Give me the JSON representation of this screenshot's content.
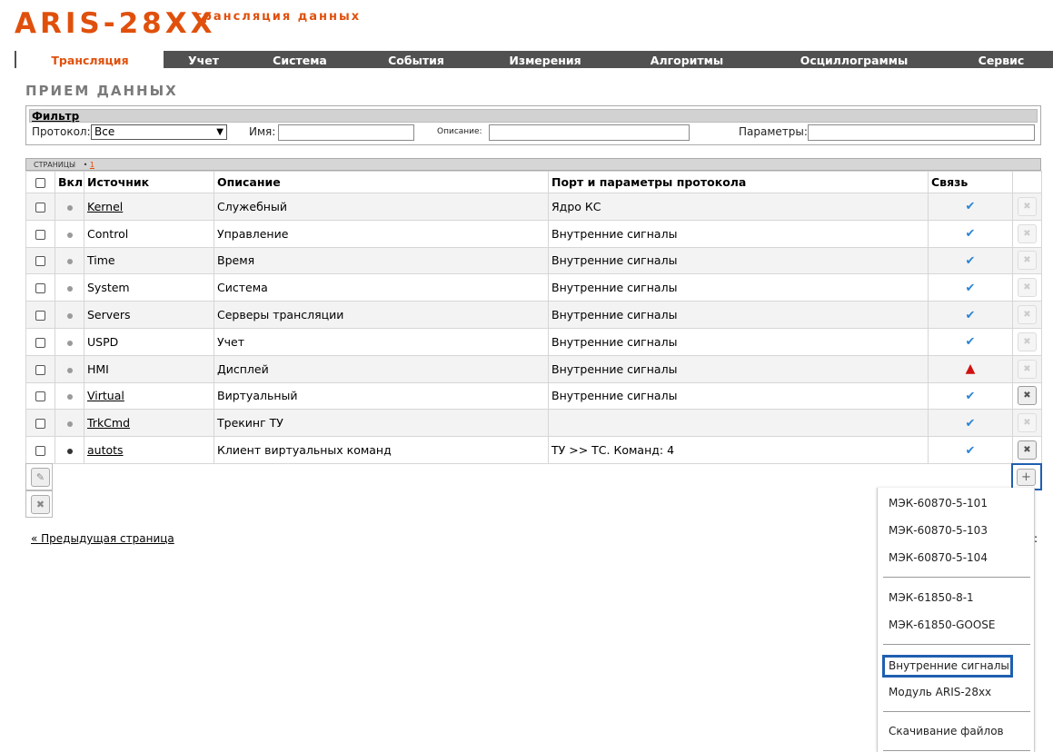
{
  "header": {
    "brand": "ARIS-28XX",
    "subtitle": "трансляция данных"
  },
  "nav": [
    {
      "label": "Трансляция",
      "active": true
    },
    {
      "label": "Учет"
    },
    {
      "label": "Система"
    },
    {
      "label": "События"
    },
    {
      "label": "Измерения"
    },
    {
      "label": "Алгоритмы"
    },
    {
      "label": "Осциллограммы"
    },
    {
      "label": "Сервис"
    }
  ],
  "page_title": "ПРИЕМ ДАННЫХ",
  "filter": {
    "title": "Фильтр",
    "protocol_label": "Протокол:",
    "protocol_value": "Все",
    "name_label": "Имя:",
    "desc_label": "Описание:",
    "params_label": "Параметры:"
  },
  "pages": {
    "label": "СТРАНИЦЫ",
    "bullet": "•",
    "current": "1"
  },
  "table": {
    "headers": [
      "Вкл",
      "Источник",
      "Описание",
      "Порт и параметры протокола",
      "Связь"
    ],
    "rows": [
      {
        "source": "Kernel",
        "link": true,
        "desc": "Служебный",
        "port": "Ядро КС",
        "status": "ok",
        "delete": false
      },
      {
        "source": "Control",
        "link": false,
        "desc": "Управление",
        "port": "Внутренние сигналы",
        "status": "ok",
        "delete": false
      },
      {
        "source": "Time",
        "link": false,
        "desc": "Время",
        "port": "Внутренние сигналы",
        "status": "ok",
        "delete": false
      },
      {
        "source": "System",
        "link": false,
        "desc": "Система",
        "port": "Внутренние сигналы",
        "status": "ok",
        "delete": false
      },
      {
        "source": "Servers",
        "link": false,
        "desc": "Серверы трансляции",
        "port": "Внутренние сигналы",
        "status": "ok",
        "delete": false
      },
      {
        "source": "USPD",
        "link": false,
        "desc": "Учет",
        "port": "Внутренние сигналы",
        "status": "ok",
        "delete": false
      },
      {
        "source": "HMI",
        "link": false,
        "desc": "Дисплей",
        "port": "Внутренние сигналы",
        "status": "warn",
        "delete": false
      },
      {
        "source": "Virtual",
        "link": true,
        "desc": "Виртуальный",
        "port": "Внутренние сигналы",
        "status": "ok",
        "delete": true
      },
      {
        "source": "TrkCmd",
        "link": true,
        "desc": "Трекинг ТУ",
        "port": "",
        "status": "ok",
        "delete": false
      },
      {
        "source": "autots",
        "link": true,
        "desc": "Клиент виртуальных команд",
        "port": "ТУ >> ТС. Команд: 4",
        "status": "ok",
        "delete": true,
        "enabled": true
      }
    ]
  },
  "prev_page": "« Предыдущая страница",
  "next_fragment": ":",
  "icons": {
    "wrench": "wrench-icon",
    "close": "close-icon",
    "plus": "plus-icon",
    "check": "check-icon",
    "warning": "warning-icon"
  },
  "menu": {
    "items": [
      "МЭК-60870-5-101",
      "МЭК-60870-5-103",
      "МЭК-60870-5-104",
      "МЭК-61850-8-1",
      "МЭК-61850-GOOSE",
      "Внутренние сигналы",
      "Модуль ARIS-28xx",
      "Скачивание файлов"
    ]
  },
  "colors": {
    "accent": "#e0500c",
    "nav_bg": "#515151",
    "highlight": "#1f5fb0",
    "ok": "#2a84d4",
    "warn": "#d01010"
  }
}
